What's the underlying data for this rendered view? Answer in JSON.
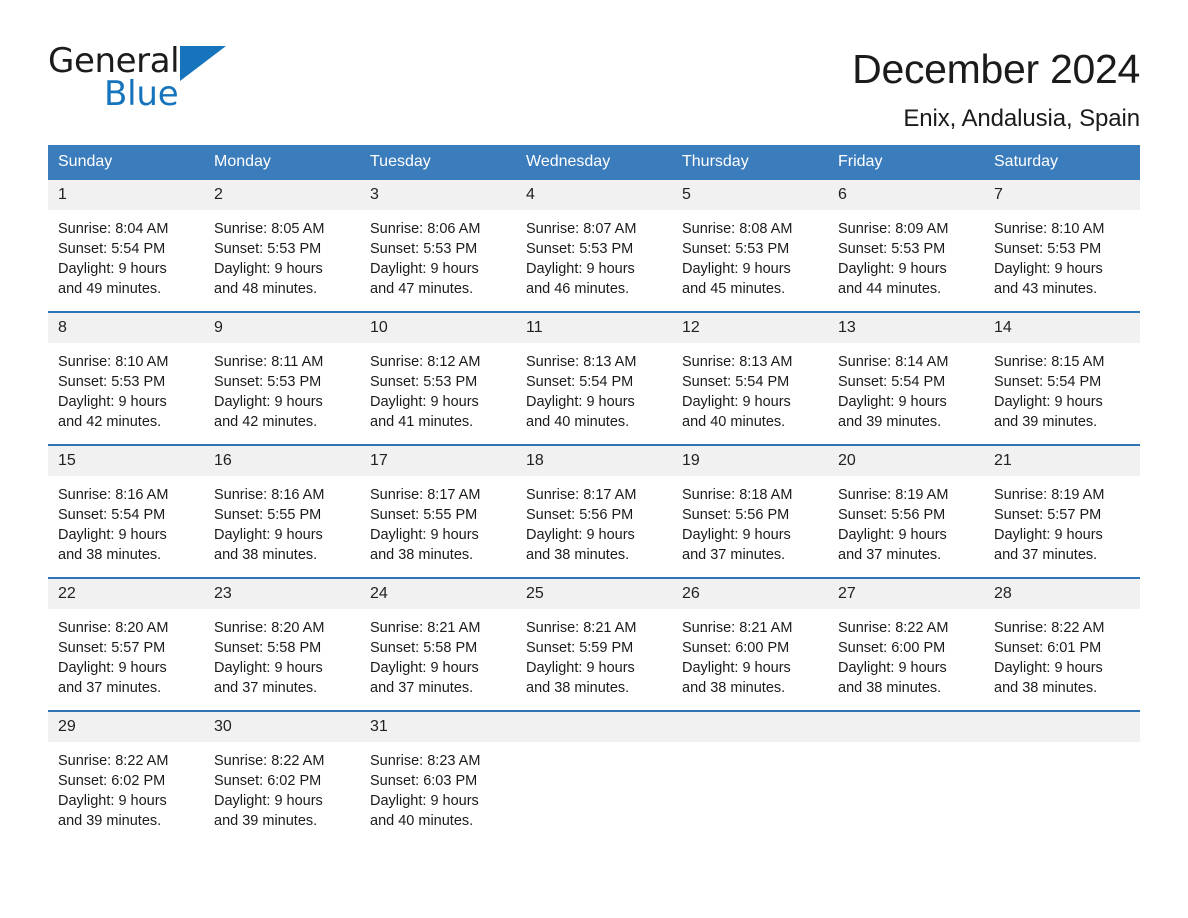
{
  "brand": {
    "name_part1": "General",
    "name_part2": "Blue",
    "triangle_icon": "triangle-logo-icon",
    "accent_color": "#1574bb"
  },
  "header": {
    "title": "December 2024",
    "subtitle": "Enix, Andalusia, Spain"
  },
  "colors": {
    "header_row_bg": "#3b7cbc",
    "week_divider": "#2f74b5",
    "date_cell_bg": "#f1f1f1",
    "text": "#1b1b1b"
  },
  "weekday_headers": [
    "Sunday",
    "Monday",
    "Tuesday",
    "Wednesday",
    "Thursday",
    "Friday",
    "Saturday"
  ],
  "weeks": [
    [
      {
        "date": "1",
        "sunrise": "Sunrise: 8:04 AM",
        "sunset": "Sunset: 5:54 PM",
        "daylight_line1": "Daylight: 9 hours",
        "daylight_line2": "and 49 minutes."
      },
      {
        "date": "2",
        "sunrise": "Sunrise: 8:05 AM",
        "sunset": "Sunset: 5:53 PM",
        "daylight_line1": "Daylight: 9 hours",
        "daylight_line2": "and 48 minutes."
      },
      {
        "date": "3",
        "sunrise": "Sunrise: 8:06 AM",
        "sunset": "Sunset: 5:53 PM",
        "daylight_line1": "Daylight: 9 hours",
        "daylight_line2": "and 47 minutes."
      },
      {
        "date": "4",
        "sunrise": "Sunrise: 8:07 AM",
        "sunset": "Sunset: 5:53 PM",
        "daylight_line1": "Daylight: 9 hours",
        "daylight_line2": "and 46 minutes."
      },
      {
        "date": "5",
        "sunrise": "Sunrise: 8:08 AM",
        "sunset": "Sunset: 5:53 PM",
        "daylight_line1": "Daylight: 9 hours",
        "daylight_line2": "and 45 minutes."
      },
      {
        "date": "6",
        "sunrise": "Sunrise: 8:09 AM",
        "sunset": "Sunset: 5:53 PM",
        "daylight_line1": "Daylight: 9 hours",
        "daylight_line2": "and 44 minutes."
      },
      {
        "date": "7",
        "sunrise": "Sunrise: 8:10 AM",
        "sunset": "Sunset: 5:53 PM",
        "daylight_line1": "Daylight: 9 hours",
        "daylight_line2": "and 43 minutes."
      }
    ],
    [
      {
        "date": "8",
        "sunrise": "Sunrise: 8:10 AM",
        "sunset": "Sunset: 5:53 PM",
        "daylight_line1": "Daylight: 9 hours",
        "daylight_line2": "and 42 minutes."
      },
      {
        "date": "9",
        "sunrise": "Sunrise: 8:11 AM",
        "sunset": "Sunset: 5:53 PM",
        "daylight_line1": "Daylight: 9 hours",
        "daylight_line2": "and 42 minutes."
      },
      {
        "date": "10",
        "sunrise": "Sunrise: 8:12 AM",
        "sunset": "Sunset: 5:53 PM",
        "daylight_line1": "Daylight: 9 hours",
        "daylight_line2": "and 41 minutes."
      },
      {
        "date": "11",
        "sunrise": "Sunrise: 8:13 AM",
        "sunset": "Sunset: 5:54 PM",
        "daylight_line1": "Daylight: 9 hours",
        "daylight_line2": "and 40 minutes."
      },
      {
        "date": "12",
        "sunrise": "Sunrise: 8:13 AM",
        "sunset": "Sunset: 5:54 PM",
        "daylight_line1": "Daylight: 9 hours",
        "daylight_line2": "and 40 minutes."
      },
      {
        "date": "13",
        "sunrise": "Sunrise: 8:14 AM",
        "sunset": "Sunset: 5:54 PM",
        "daylight_line1": "Daylight: 9 hours",
        "daylight_line2": "and 39 minutes."
      },
      {
        "date": "14",
        "sunrise": "Sunrise: 8:15 AM",
        "sunset": "Sunset: 5:54 PM",
        "daylight_line1": "Daylight: 9 hours",
        "daylight_line2": "and 39 minutes."
      }
    ],
    [
      {
        "date": "15",
        "sunrise": "Sunrise: 8:16 AM",
        "sunset": "Sunset: 5:54 PM",
        "daylight_line1": "Daylight: 9 hours",
        "daylight_line2": "and 38 minutes."
      },
      {
        "date": "16",
        "sunrise": "Sunrise: 8:16 AM",
        "sunset": "Sunset: 5:55 PM",
        "daylight_line1": "Daylight: 9 hours",
        "daylight_line2": "and 38 minutes."
      },
      {
        "date": "17",
        "sunrise": "Sunrise: 8:17 AM",
        "sunset": "Sunset: 5:55 PM",
        "daylight_line1": "Daylight: 9 hours",
        "daylight_line2": "and 38 minutes."
      },
      {
        "date": "18",
        "sunrise": "Sunrise: 8:17 AM",
        "sunset": "Sunset: 5:56 PM",
        "daylight_line1": "Daylight: 9 hours",
        "daylight_line2": "and 38 minutes."
      },
      {
        "date": "19",
        "sunrise": "Sunrise: 8:18 AM",
        "sunset": "Sunset: 5:56 PM",
        "daylight_line1": "Daylight: 9 hours",
        "daylight_line2": "and 37 minutes."
      },
      {
        "date": "20",
        "sunrise": "Sunrise: 8:19 AM",
        "sunset": "Sunset: 5:56 PM",
        "daylight_line1": "Daylight: 9 hours",
        "daylight_line2": "and 37 minutes."
      },
      {
        "date": "21",
        "sunrise": "Sunrise: 8:19 AM",
        "sunset": "Sunset: 5:57 PM",
        "daylight_line1": "Daylight: 9 hours",
        "daylight_line2": "and 37 minutes."
      }
    ],
    [
      {
        "date": "22",
        "sunrise": "Sunrise: 8:20 AM",
        "sunset": "Sunset: 5:57 PM",
        "daylight_line1": "Daylight: 9 hours",
        "daylight_line2": "and 37 minutes."
      },
      {
        "date": "23",
        "sunrise": "Sunrise: 8:20 AM",
        "sunset": "Sunset: 5:58 PM",
        "daylight_line1": "Daylight: 9 hours",
        "daylight_line2": "and 37 minutes."
      },
      {
        "date": "24",
        "sunrise": "Sunrise: 8:21 AM",
        "sunset": "Sunset: 5:58 PM",
        "daylight_line1": "Daylight: 9 hours",
        "daylight_line2": "and 37 minutes."
      },
      {
        "date": "25",
        "sunrise": "Sunrise: 8:21 AM",
        "sunset": "Sunset: 5:59 PM",
        "daylight_line1": "Daylight: 9 hours",
        "daylight_line2": "and 38 minutes."
      },
      {
        "date": "26",
        "sunrise": "Sunrise: 8:21 AM",
        "sunset": "Sunset: 6:00 PM",
        "daylight_line1": "Daylight: 9 hours",
        "daylight_line2": "and 38 minutes."
      },
      {
        "date": "27",
        "sunrise": "Sunrise: 8:22 AM",
        "sunset": "Sunset: 6:00 PM",
        "daylight_line1": "Daylight: 9 hours",
        "daylight_line2": "and 38 minutes."
      },
      {
        "date": "28",
        "sunrise": "Sunrise: 8:22 AM",
        "sunset": "Sunset: 6:01 PM",
        "daylight_line1": "Daylight: 9 hours",
        "daylight_line2": "and 38 minutes."
      }
    ],
    [
      {
        "date": "29",
        "sunrise": "Sunrise: 8:22 AM",
        "sunset": "Sunset: 6:02 PM",
        "daylight_line1": "Daylight: 9 hours",
        "daylight_line2": "and 39 minutes."
      },
      {
        "date": "30",
        "sunrise": "Sunrise: 8:22 AM",
        "sunset": "Sunset: 6:02 PM",
        "daylight_line1": "Daylight: 9 hours",
        "daylight_line2": "and 39 minutes."
      },
      {
        "date": "31",
        "sunrise": "Sunrise: 8:23 AM",
        "sunset": "Sunset: 6:03 PM",
        "daylight_line1": "Daylight: 9 hours",
        "daylight_line2": "and 40 minutes."
      },
      {
        "date": "",
        "sunrise": "",
        "sunset": "",
        "daylight_line1": "",
        "daylight_line2": ""
      },
      {
        "date": "",
        "sunrise": "",
        "sunset": "",
        "daylight_line1": "",
        "daylight_line2": ""
      },
      {
        "date": "",
        "sunrise": "",
        "sunset": "",
        "daylight_line1": "",
        "daylight_line2": ""
      },
      {
        "date": "",
        "sunrise": "",
        "sunset": "",
        "daylight_line1": "",
        "daylight_line2": ""
      }
    ]
  ]
}
